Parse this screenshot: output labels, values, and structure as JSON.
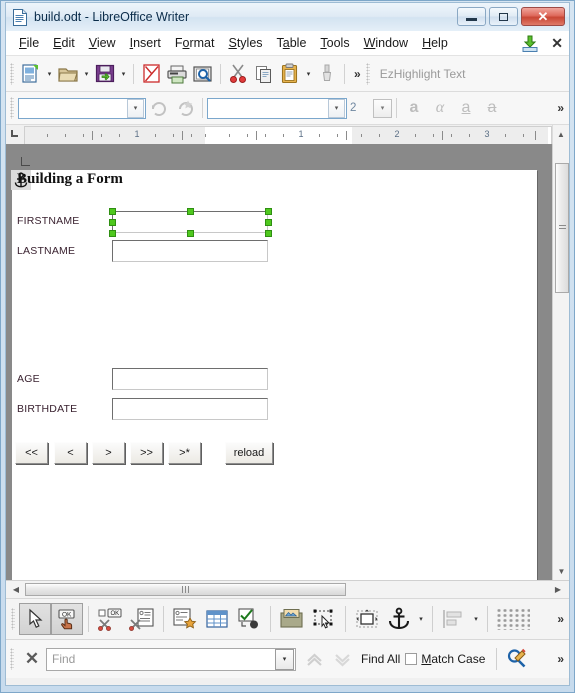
{
  "window": {
    "title": "build.odt - LibreOffice Writer",
    "doc_icon": "document-icon",
    "controls": {
      "minimize": "minimize-icon",
      "maximize": "maximize-icon",
      "close": "✕"
    }
  },
  "menubar": {
    "items": [
      {
        "label": "File",
        "accel": "F"
      },
      {
        "label": "Edit",
        "accel": "E"
      },
      {
        "label": "View",
        "accel": "V"
      },
      {
        "label": "Insert",
        "accel": "I"
      },
      {
        "label": "Format",
        "accel": "o"
      },
      {
        "label": "Styles",
        "accel": "S"
      },
      {
        "label": "Table",
        "accel": "a"
      },
      {
        "label": "Tools",
        "accel": "T"
      },
      {
        "label": "Window",
        "accel": "W"
      },
      {
        "label": "Help",
        "accel": "H"
      }
    ],
    "save_icon": "save-document-icon",
    "close_doc": "✕"
  },
  "main_toolbar": {
    "buttons": [
      {
        "name": "new-document-button",
        "tooltip": "New"
      },
      {
        "name": "open-document-button",
        "tooltip": "Open"
      },
      {
        "name": "save-document-button",
        "tooltip": "Save"
      },
      {
        "name": "export-pdf-button",
        "tooltip": "Export as PDF"
      },
      {
        "name": "print-button",
        "tooltip": "Print"
      },
      {
        "name": "print-preview-button",
        "tooltip": "Print Preview"
      },
      {
        "name": "cut-button",
        "tooltip": "Cut"
      },
      {
        "name": "copy-button",
        "tooltip": "Copy"
      },
      {
        "name": "paste-button",
        "tooltip": "Paste"
      },
      {
        "name": "clone-formatting-button",
        "tooltip": "Clone Formatting"
      }
    ],
    "overflow": "»",
    "ez_highlight_label": "EzHighlight Text"
  },
  "format_toolbar": {
    "paragraph_style": "",
    "paragraph_style_placeholder": "",
    "font_name": "",
    "font_size": "2",
    "glyphs": [
      {
        "name": "bold-button",
        "glyph": "a"
      },
      {
        "name": "italic-button",
        "glyph": "α"
      },
      {
        "name": "underline-button",
        "glyph": "a"
      },
      {
        "name": "strikethrough-button",
        "glyph": "a"
      }
    ],
    "overflow": "»"
  },
  "ruler": {
    "numbers": [
      "1",
      "1",
      "2",
      "3"
    ]
  },
  "document": {
    "heading": "Building a Form",
    "anchor_icon": "anchor-icon",
    "fields": [
      {
        "label": "FIRSTNAME",
        "value": "",
        "selected": true
      },
      {
        "label": "LASTNAME",
        "value": "",
        "selected": false
      },
      {
        "label": "AGE",
        "value": "",
        "selected": false
      },
      {
        "label": "BIRTHDATE",
        "value": "",
        "selected": false
      }
    ],
    "nav_buttons": [
      {
        "label": "<<",
        "name": "first-record-button"
      },
      {
        "label": "<",
        "name": "previous-record-button"
      },
      {
        "label": ">",
        "name": "next-record-button"
      },
      {
        "label": ">>",
        "name": "last-record-button"
      },
      {
        "label": ">*",
        "name": "new-record-button"
      },
      {
        "label": "reload",
        "name": "reload-button"
      }
    ]
  },
  "form_toolbar": {
    "buttons": [
      {
        "name": "select-tool-button",
        "pressed": true
      },
      {
        "name": "design-mode-button",
        "pressed": true
      },
      {
        "name": "control-wizards-button",
        "pressed": false
      },
      {
        "name": "form-properties-button",
        "pressed": false
      },
      {
        "name": "control-properties-button",
        "pressed": false
      },
      {
        "name": "table-control-button",
        "pressed": false
      },
      {
        "name": "check-box-button",
        "pressed": false
      },
      {
        "name": "image-control-button",
        "pressed": false
      },
      {
        "name": "select-marquee-button",
        "pressed": false
      },
      {
        "name": "position-and-size-button",
        "pressed": false
      },
      {
        "name": "anchor-button",
        "pressed": false
      },
      {
        "name": "align-objects-button",
        "pressed": false
      },
      {
        "name": "display-grid-button",
        "pressed": false
      }
    ],
    "overflow": "»"
  },
  "find_toolbar": {
    "close_icon": "✕",
    "search_value": "",
    "search_placeholder": "Find",
    "find_previous": "find-previous-icon",
    "find_next": "find-next-icon",
    "find_all_label": "Find All",
    "match_case_label": "Match Case",
    "match_case_checked": false,
    "find_replace_icon": "find-and-replace-icon",
    "overflow": "»"
  },
  "scrollbars": {
    "vertical_up": "▲",
    "vertical_down": "▼",
    "horizontal_left": "◀",
    "horizontal_right": "▶"
  },
  "colors": {
    "frame": "#c7dbed",
    "selection_handle": "#4fc81e",
    "close_button": "#c94634",
    "label_text": "#3a2230"
  }
}
